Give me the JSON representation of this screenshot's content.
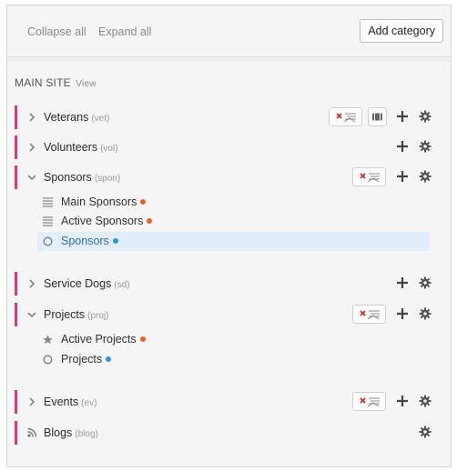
{
  "toolbar": {
    "collapse_all": "Collapse all",
    "expand_all": "Expand all",
    "add_category": "Add category"
  },
  "site": {
    "title": "MAIN SITE",
    "view_link": "View"
  },
  "categories": [
    {
      "name": "Veterans",
      "code": "(vet)",
      "expanded": false
    },
    {
      "name": "Volunteers",
      "code": "(vol)",
      "expanded": false
    },
    {
      "name": "Sponsors",
      "code": "(spon)",
      "expanded": true,
      "children": [
        {
          "name": "Main Sponsors",
          "icon": "list-icon",
          "status": "orange"
        },
        {
          "name": "Active Sponsors",
          "icon": "list-icon",
          "status": "orange"
        },
        {
          "name": "Sponsors",
          "icon": "circle-icon",
          "status": "blue",
          "selected": true
        }
      ]
    },
    {
      "name": "Service Dogs",
      "code": "(sd)",
      "expanded": false
    },
    {
      "name": "Projects",
      "code": "(proj)",
      "expanded": true,
      "children": [
        {
          "name": "Active Projects",
          "icon": "star-icon",
          "status": "orange"
        },
        {
          "name": "Projects",
          "icon": "circle-icon",
          "status": "blue"
        }
      ]
    },
    {
      "name": "Events",
      "code": "(ev)",
      "expanded": false
    },
    {
      "name": "Blogs",
      "code": "(blog)",
      "icon": "rss-icon"
    }
  ],
  "colors": {
    "accent_bar": "#c9407d",
    "status_orange": "#e8632a",
    "status_blue": "#2b9bd4",
    "selected_bg": "#e3eefb",
    "remove_x": "#d0312d"
  }
}
